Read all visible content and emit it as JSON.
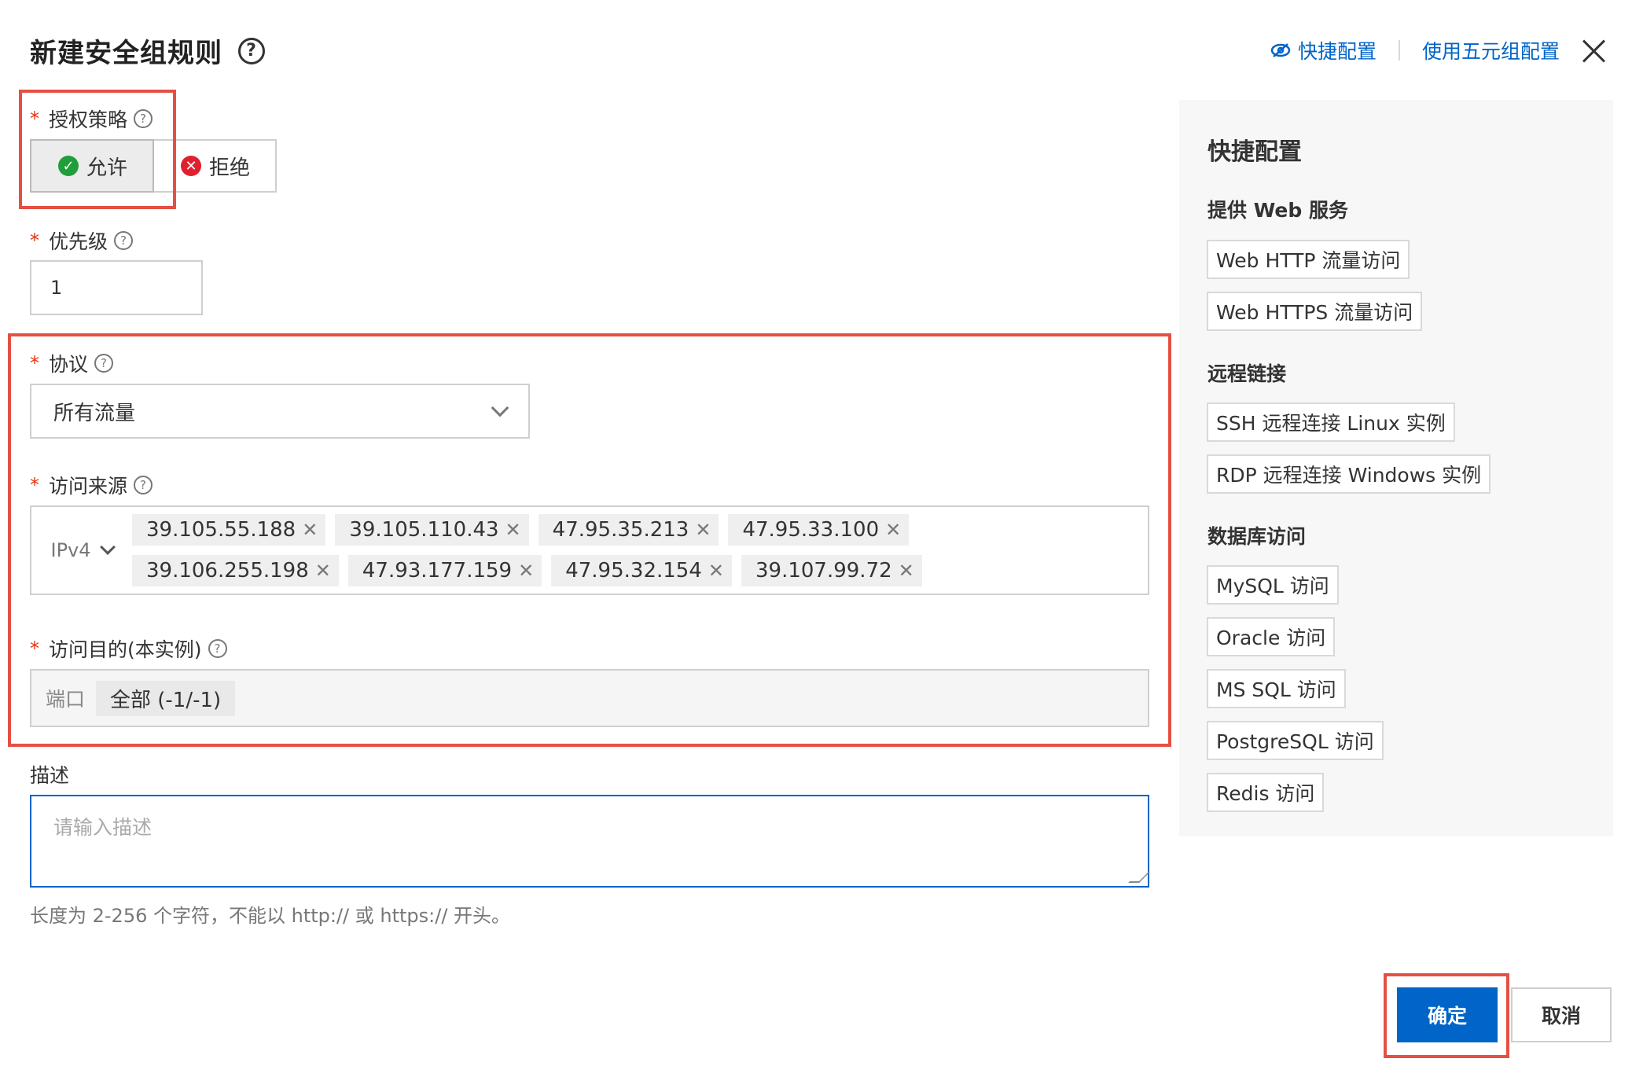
{
  "dialog": {
    "title": "新建安全组规则",
    "help_glyph": "?"
  },
  "header": {
    "quick_config_link": "快捷配置",
    "five_tuple_link": "使用五元组配置"
  },
  "policy": {
    "required_mark": "*",
    "label": "授权策略",
    "options": [
      {
        "label": "允许",
        "selected": true,
        "icon": "check-circle-icon"
      },
      {
        "label": "拒绝",
        "selected": false,
        "icon": "x-circle-icon"
      }
    ]
  },
  "priority": {
    "required_mark": "*",
    "label": "优先级",
    "value": "1"
  },
  "protocol": {
    "required_mark": "*",
    "label": "协议",
    "selected": "所有流量"
  },
  "source": {
    "required_mark": "*",
    "label": "访问来源",
    "ip_version": "IPv4",
    "tags": [
      "39.105.55.188",
      "39.105.110.43",
      "47.95.35.213",
      "47.95.33.100",
      "39.106.255.198",
      "47.93.177.159",
      "47.95.32.154",
      "39.107.99.72"
    ]
  },
  "destination": {
    "required_mark": "*",
    "label": "访问目的(本实例)",
    "port_label": "端口",
    "port_value": "全部 (-1/-1)"
  },
  "description": {
    "label": "描述",
    "placeholder": "请输入描述",
    "hint": "长度为 2-256 个字符，不能以 http:// 或 https:// 开头。"
  },
  "quick_panel": {
    "title": "快捷配置",
    "groups": [
      {
        "title": "提供 Web 服务",
        "items": [
          "Web HTTP 流量访问",
          "Web HTTPS 流量访问"
        ]
      },
      {
        "title": "远程链接",
        "items": [
          "SSH 远程连接 Linux 实例",
          "RDP 远程连接 Windows 实例"
        ]
      },
      {
        "title": "数据库访问",
        "items": [
          "MySQL 访问",
          "Oracle 访问",
          "MS SQL 访问",
          "PostgreSQL 访问",
          "Redis 访问"
        ]
      }
    ]
  },
  "footer": {
    "confirm": "确定",
    "cancel": "取消"
  },
  "colors": {
    "primary": "#0064c8",
    "highlight_frame": "#e55044",
    "allow": "#1f9e3b",
    "deny": "#e0202f"
  }
}
